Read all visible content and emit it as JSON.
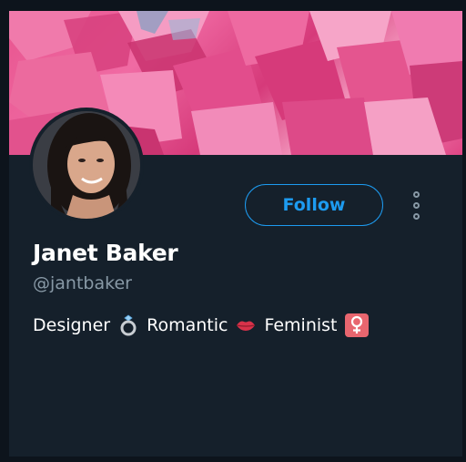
{
  "profile": {
    "name": "Janet Baker",
    "handle": "@jantbaker",
    "bio": {
      "part1": "Designer",
      "part2": "Romantic",
      "part3": "Feminist"
    },
    "bio_icons": [
      "ring-icon",
      "lips-icon",
      "female-sign-icon"
    ]
  },
  "actions": {
    "follow_label": "Follow",
    "more_icon": "vertical-ellipsis-icon"
  },
  "colors": {
    "background": "#15202b",
    "accent": "#1d9bf0",
    "secondary_text": "#8899a6",
    "banner_pink": "#e8558f"
  }
}
